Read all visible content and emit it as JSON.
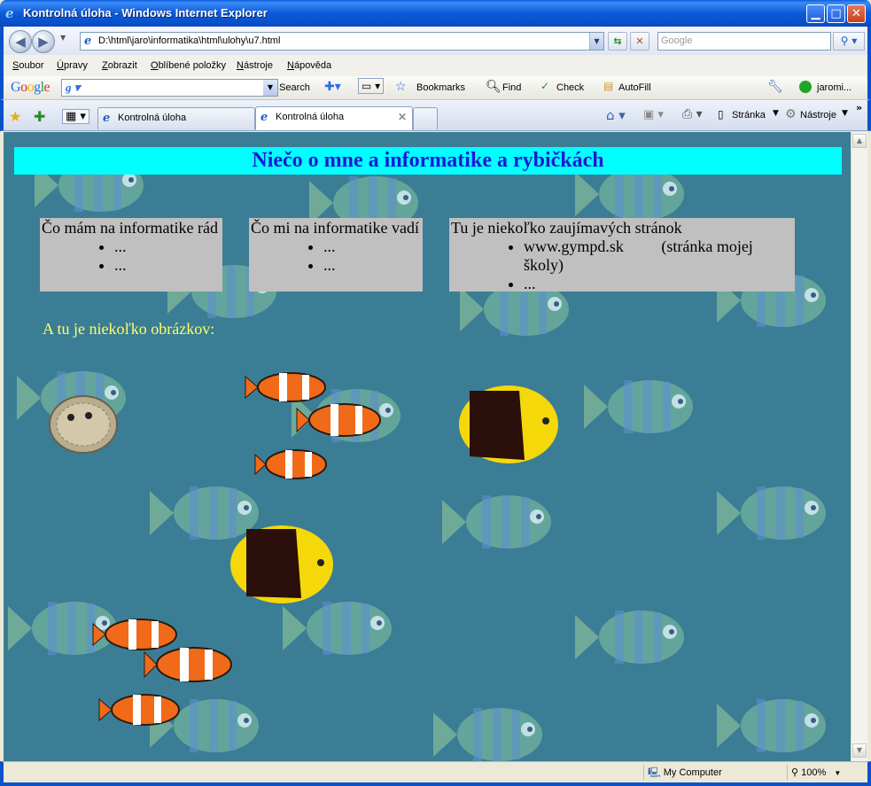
{
  "window": {
    "title": "Kontrolná úloha - Windows Internet Explorer",
    "minimize_glyph": "▁",
    "maximize_glyph": "□",
    "close_glyph": "✕"
  },
  "address_bar": {
    "url": "D:\\html\\jaro\\informatika\\html\\ulohy\\u7.html",
    "search_placeholder": "Google"
  },
  "menu": [
    "Soubor",
    "Úpravy",
    "Zobrazit",
    "Oblíbené položky",
    "Nástroje",
    "Nápověda"
  ],
  "google_toolbar": {
    "logo": "Google",
    "search_label": "Search",
    "bookmarks": "Bookmarks",
    "find": "Find",
    "check": "Check",
    "autofill": "AutoFill",
    "user": "jaromi..."
  },
  "tabs": [
    {
      "label": "Kontrolná úloha",
      "active": false
    },
    {
      "label": "Kontrolná úloha",
      "active": true
    }
  ],
  "command_bar": {
    "page": "Stránka",
    "tools": "Nástroje"
  },
  "page": {
    "heading": "Niečo o mne a informatike a rybičkách",
    "likes": {
      "title": "Čo mám na informatike rád",
      "items": [
        "...",
        "..."
      ]
    },
    "dislikes": {
      "title": "Čo mi na informatike vadí",
      "items": [
        "...",
        "..."
      ]
    },
    "links": {
      "title": "Tu je niekoľko zaujímavých stránok",
      "items": [
        {
          "text": "www.gympd.sk",
          "note": "(stránka mojej školy)"
        },
        {
          "text": "...",
          "note": ""
        }
      ]
    },
    "pictures_caption": "A tu je niekoľko obrázkov:"
  },
  "status_bar": {
    "zone": "My Computer",
    "zoom": "100%"
  },
  "colors": {
    "heading_bg": "#00ffff",
    "heading_text": "#1a1ad6",
    "page_bg": "#3b7d95",
    "box_bg": "#c0c0c0",
    "caption_text": "#ffff66"
  }
}
